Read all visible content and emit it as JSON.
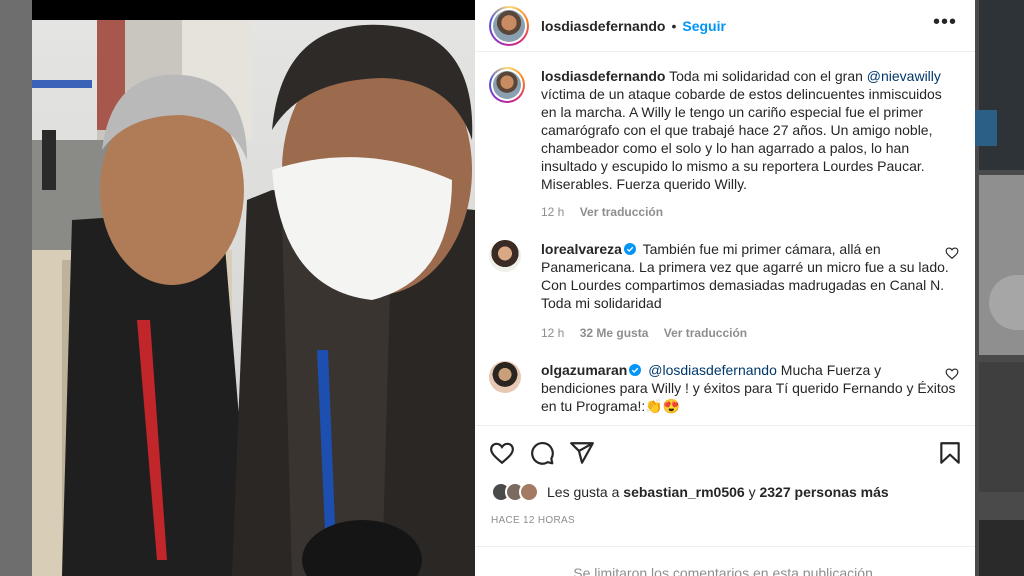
{
  "post": {
    "username": "losdiasdefernando",
    "separator": "•",
    "follow_label": "Seguir",
    "more_label": "•••"
  },
  "caption": {
    "username": "losdiasdefernando",
    "text_before": "Toda mi solidaridad con el gran ",
    "mention": "@nievawilly",
    "text_after": " víctima de un ataque cobarde de estos delincuentes inmiscuidos en la marcha. A Willy le tengo un cariño especial fue el primer camarógrafo con el que trabajé hace 27 años. Un amigo noble, chambeador como el solo y lo han agarrado a palos, lo han insultado y escupido lo mismo a su reportera Lourdes Paucar. Miserables. Fuerza querido Willy.",
    "time": "12 h",
    "translate": "Ver traducción"
  },
  "comments": [
    {
      "username": "lorealvareza",
      "text": "También fue mi primer cámara, allá en Panamericana. La primera vez que agarré un micro fue a su lado. Con Lourdes compartimos demasiadas madrugadas en Canal N. Toda mi solidaridad",
      "time": "12 h",
      "likes": "32 Me gusta",
      "translate": "Ver traducción"
    },
    {
      "username": "olgazumaran",
      "mention": "@losdiasdefernando",
      "text": " Mucha Fuerza y bendiciones para Willy ! y éxitos para Tí querido Fernando y Éxitos en tu Programa!:",
      "emoji": "👏😍"
    }
  ],
  "likes": {
    "prefix": "Les gusta a ",
    "user": "sebastian_rm0506",
    "middle": " y ",
    "count": "2327 personas más"
  },
  "time_ago": "HACE 12 HORAS",
  "footer_text": "Se limitaron los comentarios en esta publicación.",
  "icons": [
    "heart-icon",
    "comment-icon",
    "share-icon",
    "bookmark-icon",
    "more-icon",
    "verified-icon"
  ],
  "colors": {
    "link": "#0095f6",
    "mention": "#00376b",
    "muted": "#8e8e8e",
    "verified": "#0095f6"
  }
}
